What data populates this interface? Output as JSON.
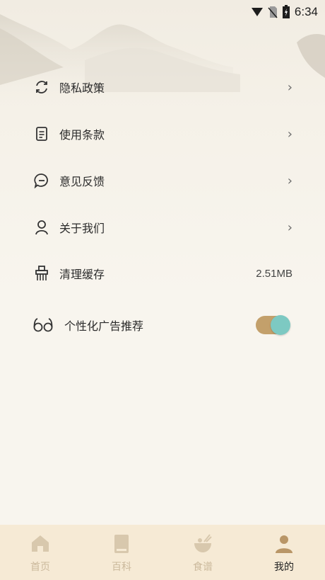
{
  "status_bar": {
    "time": "6:34"
  },
  "menu": {
    "items": [
      {
        "label": "隐私政策",
        "icon": "refresh-icon"
      },
      {
        "label": "使用条款",
        "icon": "document-icon"
      },
      {
        "label": "意见反馈",
        "icon": "chat-bubble-icon"
      },
      {
        "label": "关于我们",
        "icon": "user-icon"
      }
    ],
    "cache": {
      "label": "清理缓存",
      "value": "2.51MB",
      "icon": "broom-icon"
    },
    "ads": {
      "label": "个性化广告推荐",
      "icon": "glasses-icon",
      "enabled": true
    }
  },
  "tabbar": {
    "tabs": [
      {
        "label": "首页",
        "icon": "home-icon"
      },
      {
        "label": "百科",
        "icon": "book-icon"
      },
      {
        "label": "食谱",
        "icon": "bowl-icon"
      },
      {
        "label": "我的",
        "icon": "person-icon",
        "active": true
      }
    ]
  },
  "colors": {
    "accent": "#c3a06b",
    "toggle_knob": "#7dc9c2",
    "tabbar_bg": "#f6ead5",
    "inactive_tab": "#cbb99c"
  }
}
